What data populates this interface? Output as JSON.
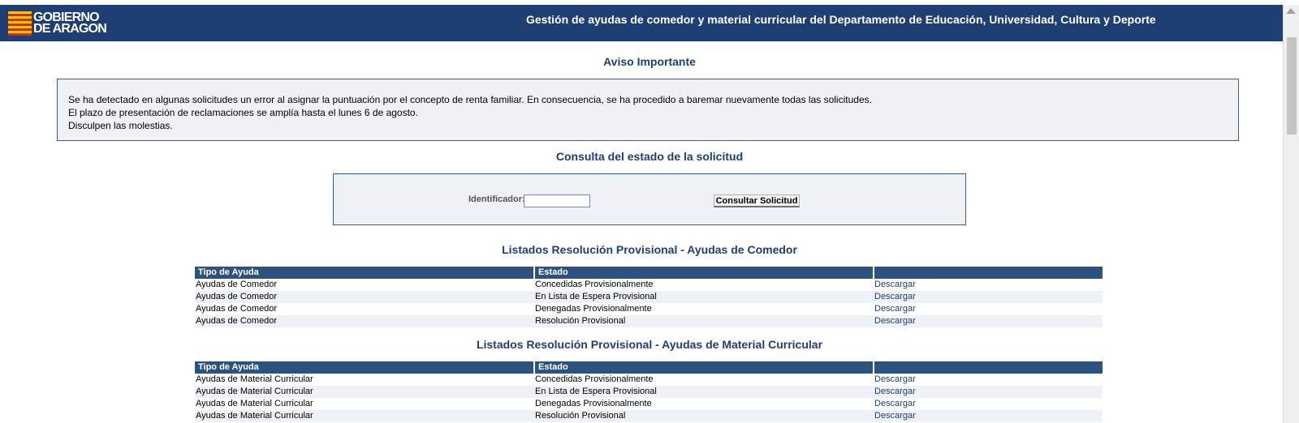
{
  "header": {
    "logo_line1": "GOBIERNO",
    "logo_line2": "DE ARAGON",
    "title": "Gestión de ayudas de comedor y material curricular del Departamento de Educación, Universidad, Cultura y Deporte"
  },
  "notice": {
    "title": "Aviso Importante",
    "line1": "Se ha detectado en algunas solicitudes un error al asignar la puntuación por el concepto de renta familiar. En consecuencia, se ha procedido a baremar nuevamente todas las solicitudes.",
    "line2": "El plazo de presentación de reclamaciones se amplía hasta el lunes 6 de agosto.",
    "line3": "Disculpen las molestias."
  },
  "query": {
    "title": "Consulta del estado de la solicitud",
    "id_label": "Identificador:",
    "id_value": "",
    "button_label": "Consultar Solicitud"
  },
  "comedor": {
    "title": "Listados Resolución Provisional - Ayudas de Comedor",
    "headers": [
      "Tipo de Ayuda",
      "Estado",
      ""
    ],
    "rows": [
      {
        "tipo": "Ayudas de Comedor",
        "estado": "Concedidas Provisionalmente",
        "link": "Descargar"
      },
      {
        "tipo": "Ayudas de Comedor",
        "estado": "En Lista de Espera Provisional",
        "link": "Descargar"
      },
      {
        "tipo": "Ayudas de Comedor",
        "estado": "Denegadas Provisionalmente",
        "link": "Descargar"
      },
      {
        "tipo": "Ayudas de Comedor",
        "estado": "Resolución Provisional",
        "link": "Descargar"
      }
    ]
  },
  "material": {
    "title": "Listados Resolución Provisional - Ayudas de Material Curricular",
    "headers": [
      "Tipo de Ayuda",
      "Estado",
      ""
    ],
    "rows": [
      {
        "tipo": "Ayudas de Material Curricular",
        "estado": "Concedidas Provisionalmente",
        "link": "Descargar"
      },
      {
        "tipo": "Ayudas de Material Curricular",
        "estado": "En Lista de Espera Provisional",
        "link": "Descargar"
      },
      {
        "tipo": "Ayudas de Material Curricular",
        "estado": "Denegadas Provisionalmente",
        "link": "Descargar"
      },
      {
        "tipo": "Ayudas de Material Curricular",
        "estado": "Resolución Provisional",
        "link": "Descargar"
      }
    ]
  },
  "colors": {
    "header_bg": "#1f3e73",
    "table_header_bg": "#2c5282",
    "accent_text": "#1f3e73",
    "panel_bg": "#eef1f6"
  }
}
